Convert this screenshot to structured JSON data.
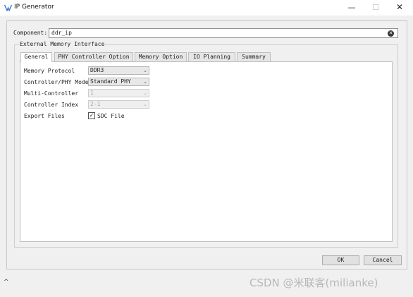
{
  "window": {
    "title": "IP Generator",
    "minimize": "—",
    "maximize": "☐",
    "close": "✕"
  },
  "component": {
    "label": "Component:",
    "value": "ddr_ip",
    "clear_glyph": "✕"
  },
  "group": {
    "title": "External Memory Interface"
  },
  "tabs": [
    {
      "label": "General",
      "active": true
    },
    {
      "label": "PHY Controller Option",
      "active": false
    },
    {
      "label": "Memory Option",
      "active": false
    },
    {
      "label": "IO Planning",
      "active": false
    },
    {
      "label": "Summary",
      "active": false
    }
  ],
  "general": {
    "memory_protocol": {
      "label": "Memory Protocol",
      "value": "DDR3"
    },
    "controller_phy_mode": {
      "label": "Controller/PHY Mode",
      "value": "Standard PHY"
    },
    "multi_controller": {
      "label": "Multi-Controller",
      "value": "1",
      "disabled": true
    },
    "controller_index": {
      "label": "Controller Index",
      "value": "2-1",
      "disabled": true
    },
    "export_files": {
      "label": "Export Files",
      "checkbox_label": "SDC File",
      "checked": true,
      "check_glyph": "✓"
    }
  },
  "buttons": {
    "ok": "OK",
    "cancel": "Cancel"
  },
  "footer": {
    "expand_glyph": "^",
    "watermark": "CSDN @米联客(milianke)"
  },
  "colors": {
    "window_bg": "#f0f0f0",
    "panel_bg": "#ffffff",
    "text": "#1e1e1e"
  }
}
